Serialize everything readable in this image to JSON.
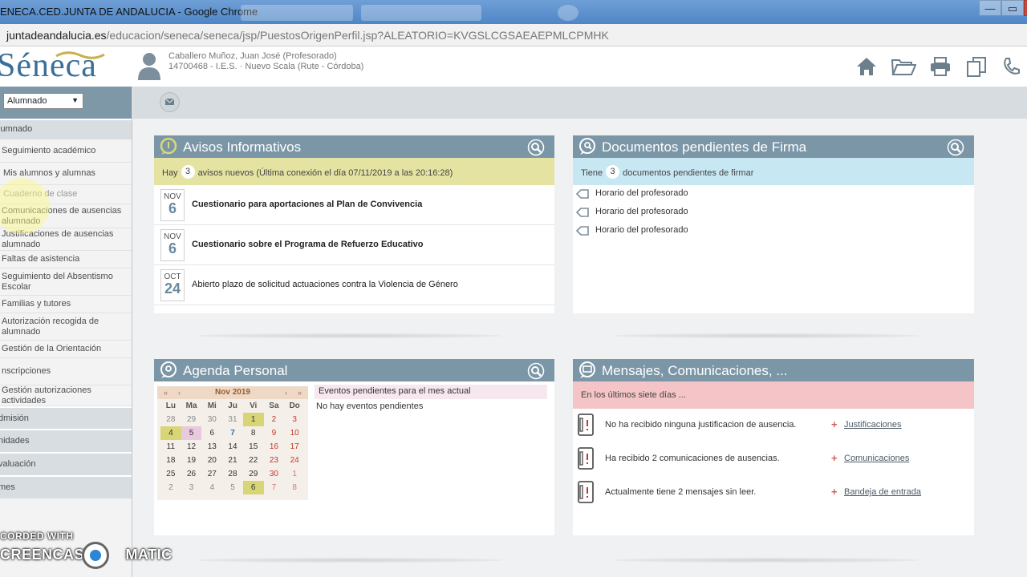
{
  "window": {
    "title": "ENECA.CED.JUNTA DE ANDALUCIA - Google Chrome",
    "controls": {
      "minimize": "—",
      "maximize": "▭",
      "close": "✕"
    }
  },
  "address": {
    "domain": "juntadeandalucia.es",
    "path": "/educacion/seneca/seneca/jsp/PuestosOrigenPerfil.jsp?ALEATORIO=KVGSLCGSAEAEPMLCPMHK"
  },
  "header": {
    "logo_text": "Séneca",
    "user_name": "Caballero Muñoz, Juan José (Profesorado)",
    "user_center": "14700468 - I.E.S. · Nuevo Scala (Rute - Córdoba)"
  },
  "sidebar": {
    "profile_value": "Alumnado",
    "items": [
      {
        "label": "lumnado",
        "type": "section"
      },
      {
        "label": "Seguimiento académico",
        "type": "item"
      },
      {
        "label": "Mis alumnos y alumnas",
        "type": "item"
      },
      {
        "label": "Cuaderno de clase",
        "type": "item-muted"
      },
      {
        "label": "Comunicaciones de ausencias alumnado",
        "type": "item"
      },
      {
        "label": "Justificaciones de ausencias alumnado",
        "type": "item"
      },
      {
        "label": "Faltas de asistencia",
        "type": "item"
      },
      {
        "label": "Seguimiento del Absentismo Escolar",
        "type": "item"
      },
      {
        "label": "Familias y tutores",
        "type": "item"
      },
      {
        "label": "Autorización recogida de alumnado",
        "type": "item"
      },
      {
        "label": "Gestión de la Orientación",
        "type": "item"
      },
      {
        "label": "nscripciones",
        "type": "item"
      },
      {
        "label": "Gestión autorizaciones actividades",
        "type": "item"
      },
      {
        "label": "dmisión",
        "type": "section"
      },
      {
        "label": "nidades",
        "type": "section"
      },
      {
        "label": "valuación",
        "type": "section"
      },
      {
        "label": "mes",
        "type": "section"
      }
    ]
  },
  "avisos": {
    "title": "Avisos Informativos",
    "prefix": "Hay",
    "count": "3",
    "suffix": "avisos nuevos (Última conexión el día 07/11/2019 a las 20:16:28)",
    "items": [
      {
        "month": "NOV",
        "day": "6",
        "text": "Cuestionario para aportaciones al Plan de Convivencia",
        "bold": true
      },
      {
        "month": "NOV",
        "day": "6",
        "text": "Cuestionario sobre el Programa de Refuerzo Educativo",
        "bold": true
      },
      {
        "month": "OCT",
        "day": "24",
        "text": "Abierto plazo de solicitud actuaciones contra la Violencia de Género",
        "bold": false
      }
    ]
  },
  "documentos": {
    "title": "Documentos pendientes de Firma",
    "prefix": "Tiene",
    "count": "3",
    "suffix": "documentos pendientes de firmar",
    "items": [
      "Horario del profesorado",
      "Horario del profesorado",
      "Horario del profesorado"
    ]
  },
  "agenda": {
    "title": "Agenda Personal",
    "month_label": "Nov 2019",
    "nav": {
      "first": "«",
      "prev": "‹",
      "next": "›",
      "last": "»"
    },
    "weekdays": [
      "Lu",
      "Ma",
      "Mi",
      "Ju",
      "Vi",
      "Sa",
      "Do"
    ],
    "weeks": [
      [
        "28",
        "29",
        "30",
        "31",
        "1",
        "2",
        "3"
      ],
      [
        "4",
        "5",
        "6",
        "7",
        "8",
        "9",
        "10"
      ],
      [
        "11",
        "12",
        "13",
        "14",
        "15",
        "16",
        "17"
      ],
      [
        "18",
        "19",
        "20",
        "21",
        "22",
        "23",
        "24"
      ],
      [
        "25",
        "26",
        "27",
        "28",
        "29",
        "30",
        "1"
      ],
      [
        "2",
        "3",
        "4",
        "5",
        "6",
        "7",
        "8"
      ]
    ],
    "events_header": "Eventos pendientes para el mes actual",
    "events_none": "No hay eventos pendientes"
  },
  "mensajes": {
    "title": "Mensajes, Comunicaciones, ...",
    "subtitle": "En los últimos siete días ...",
    "items": [
      {
        "text": "No ha recibido ninguna justificacion de ausencia.",
        "link": "Justificaciones"
      },
      {
        "text": "Ha recibido 2 comunicaciones de ausencias.",
        "link": "Comunicaciones"
      },
      {
        "text": "Actualmente tiene 2 mensajes sin leer.",
        "link": "Bandeja de entrada"
      }
    ]
  },
  "watermark": {
    "line1": "CORDED WITH",
    "line2a": "CREENCAST",
    "line2b": "MATIC"
  },
  "colors": {
    "panel_header": "#7b96a7",
    "avisos_bar": "#e5e3a2",
    "docs_bar": "#c7e8f3",
    "msgs_bar": "#f5c4c6",
    "weekend_red": "#c0392b",
    "cal_highlight": "#d8d576"
  }
}
